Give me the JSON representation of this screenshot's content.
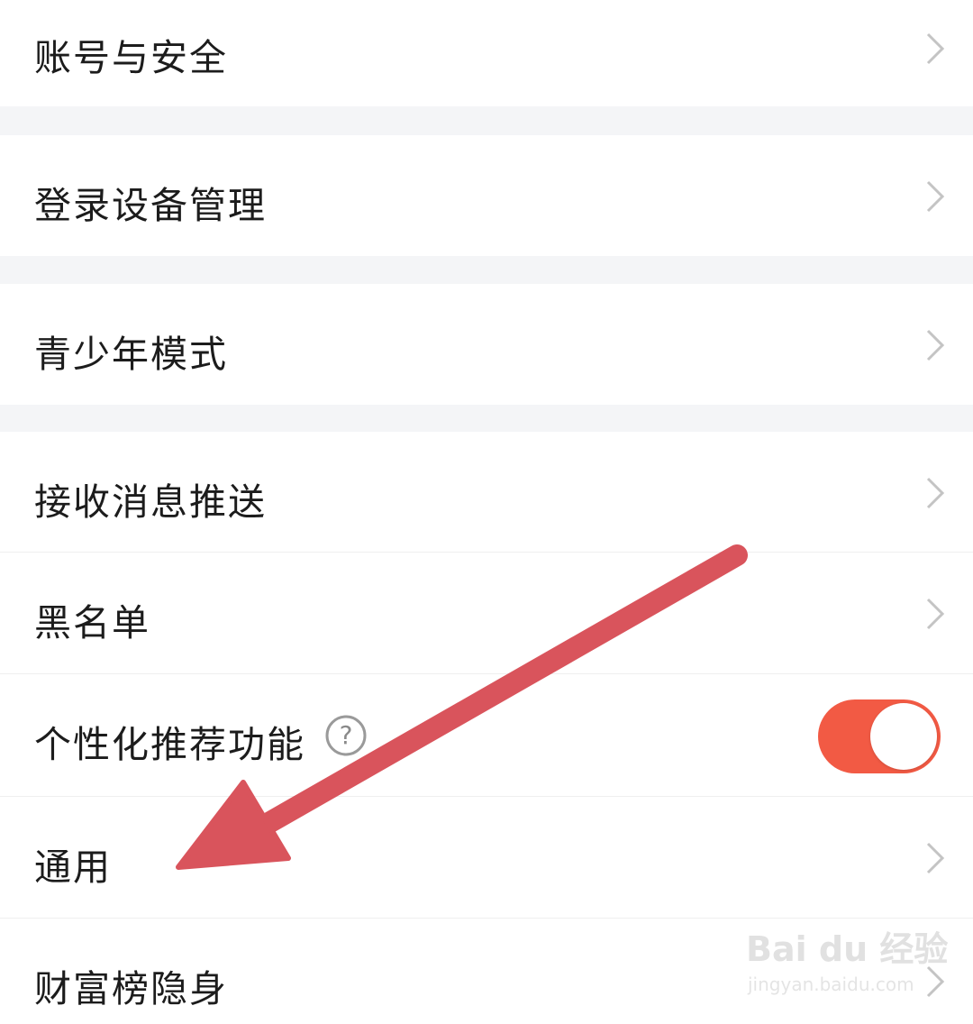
{
  "settings": {
    "items": [
      {
        "label": "账号与安全"
      },
      {
        "label": "登录设备管理"
      },
      {
        "label": "青少年模式"
      },
      {
        "label": "接收消息推送"
      },
      {
        "label": "黑名单"
      },
      {
        "label": "个性化推荐功能",
        "toggle_on": true
      },
      {
        "label": "通用"
      },
      {
        "label": "财富榜隐身"
      }
    ]
  },
  "help_icon_glyph": "?",
  "icons": {
    "chevron": "chevron-right-icon",
    "help": "question-circle-icon"
  },
  "colors": {
    "toggle_on": "#f25a44",
    "annotation_arrow": "#d9545c",
    "section_gap": "#f4f5f7"
  },
  "watermark": {
    "logo": "Bai du 经验",
    "url": "jingyan.baidu.com"
  }
}
